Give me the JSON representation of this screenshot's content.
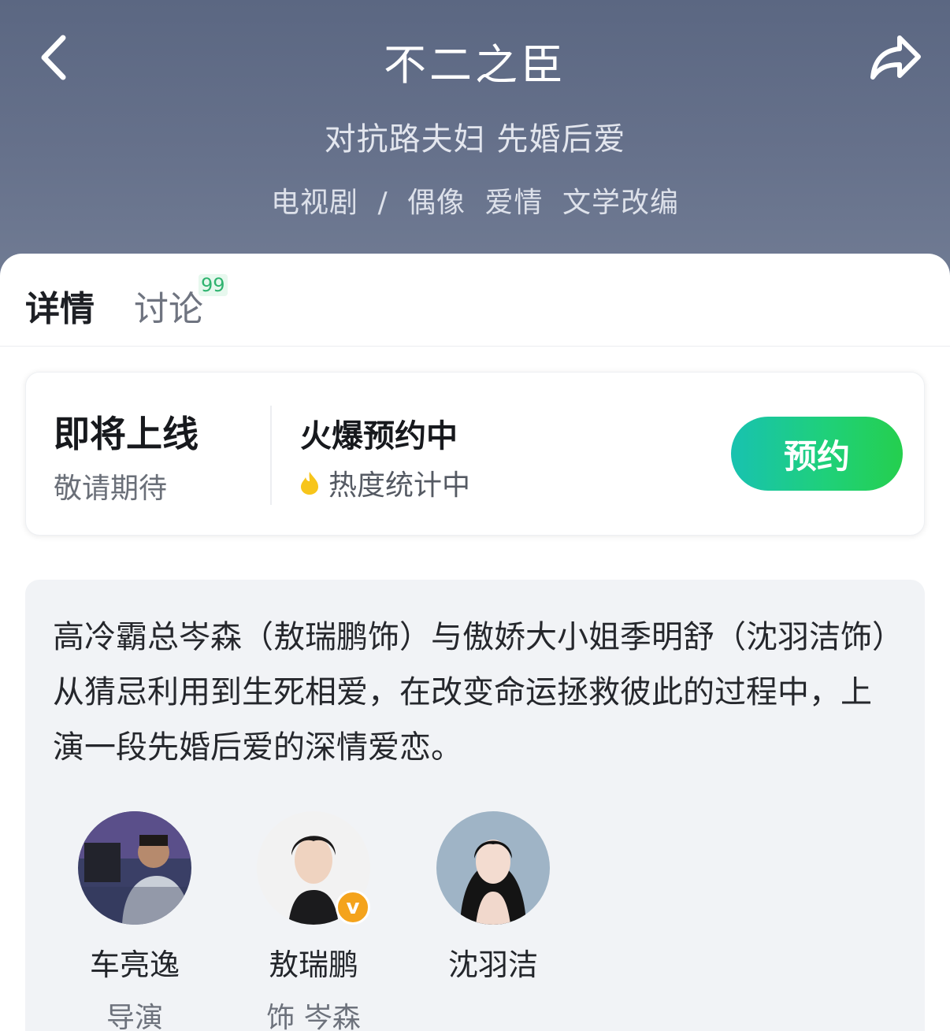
{
  "header": {
    "title": "不二之臣",
    "tagline": "对抗路夫妇 先婚后爱",
    "genre": {
      "category": "电视剧",
      "separator": "/",
      "tags": [
        "偶像",
        "爱情",
        "文学改编"
      ]
    }
  },
  "tabs": {
    "details_label": "详情",
    "discuss_label": "讨论",
    "discuss_badge": "99"
  },
  "status": {
    "main": "即将上线",
    "sub": "敬请期待",
    "heat_main": "火爆预约中",
    "heat_sub": "热度统计中",
    "reserve_label": "预约"
  },
  "synopsis": "高冷霸总岑森（敖瑞鹏饰）与傲娇大小姐季明舒（沈羽洁饰）从猜忌利用到生死相爱，在改变命运拯救彼此的过程中，上演一段先婚后爱的深情爱恋。",
  "cast": [
    {
      "name": "车亮逸",
      "role": "导演"
    },
    {
      "name": "敖瑞鹏",
      "role": "饰 岑森",
      "badge": "v"
    },
    {
      "name": "沈羽洁",
      "role": ""
    }
  ],
  "colors": {
    "header_bg": "#66718b",
    "accent_green": "#1fd07a",
    "badge_green": "#2fb36f",
    "vip_orange": "#f4a31c"
  }
}
